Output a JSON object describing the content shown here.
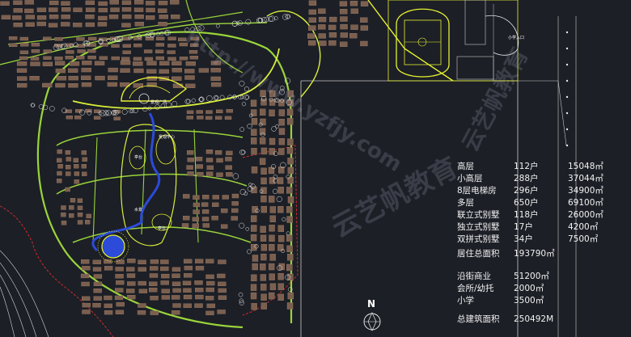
{
  "colors": {
    "background": "#1c1f26",
    "road": "#9ad43a",
    "road_bright": "#d8ef3a",
    "building": "#8a6b58",
    "water": "#2b4bd8",
    "boundary_red": "#d12b2b",
    "tree": "#e8e8e8",
    "field": "#e8f230"
  },
  "plan_labels": {
    "plaza": "景观广场",
    "school_gate": "小学入口",
    "center": "景观中心",
    "pavilion_1": "亭台",
    "pavilion_2": "亭台",
    "water_label": "水景"
  },
  "north_label": "N",
  "stats": {
    "rows": [
      {
        "name": "高层",
        "count": "112户",
        "area": "15048㎡"
      },
      {
        "name": "小高层",
        "count": "288户",
        "area": "37044㎡"
      },
      {
        "name": "8层电梯房",
        "count": "296户",
        "area": "34900㎡"
      },
      {
        "name": "多层",
        "count": "650户",
        "area": "69100㎡"
      },
      {
        "name": "联立式别墅",
        "count": "118户",
        "area": "26000㎡"
      },
      {
        "name": "独立式别墅",
        "count": "17户",
        "area": "4200㎡"
      },
      {
        "name": "双拼式别墅",
        "count": "34户",
        "area": "7500㎡"
      }
    ],
    "residential_total_label": "居住总面积",
    "residential_total_value": "193790㎡",
    "extra_rows": [
      {
        "name": "沿街商业",
        "value": "51200㎡"
      },
      {
        "name": "会所/幼托",
        "value": "2000㎡"
      },
      {
        "name": "小学",
        "value": "3500㎡"
      }
    ],
    "grand_total_label": "总建筑面积",
    "grand_total_value": "250492M"
  },
  "watermarks": {
    "url": "http://www.yzfjy.com",
    "brand": "云艺帆教育"
  }
}
